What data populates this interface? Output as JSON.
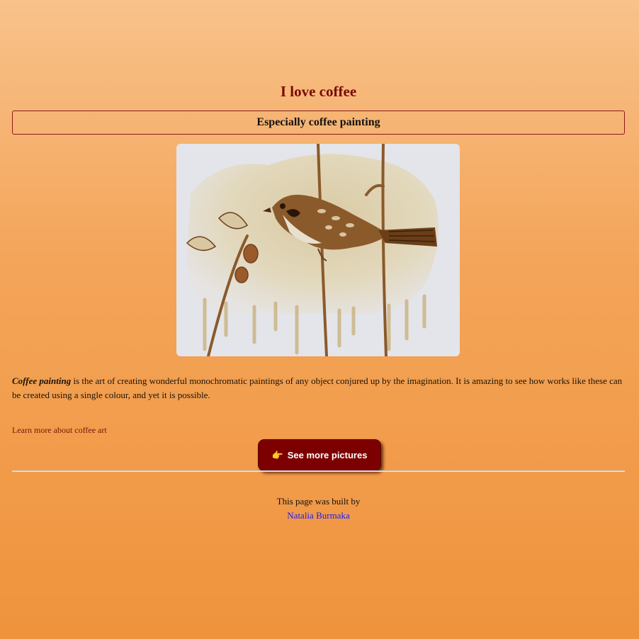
{
  "header": {
    "title": "I love coffee",
    "subtitle": "Especially coffee painting"
  },
  "painting": {
    "alt": "Coffee painting of a sparrow on a branch",
    "subject_icon": "sparrow-painting"
  },
  "description": {
    "emphasis": "Coffee painting",
    "text": " is the art of creating wonderful monochromatic paintings of any object conjured up by the imagination. It is amazing to see how works like these can be created using a single colour, and yet it is possible."
  },
  "links": {
    "learn_more": "Learn more about coffee art"
  },
  "button": {
    "icon": "👉",
    "label": "See more pictures",
    "color": "#7d0000"
  },
  "footer": {
    "built_by": "This page was built by",
    "author": "Natalia Burmaka"
  },
  "colors": {
    "title": "#7a0a05",
    "link": "#7a1208",
    "author_link": "#1a1aff",
    "background_top": "#f8c28b",
    "background_bottom": "#ef933c"
  }
}
